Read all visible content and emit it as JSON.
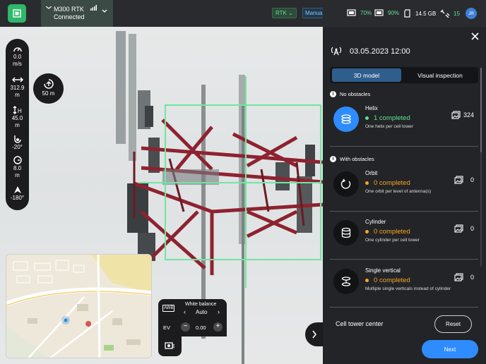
{
  "top_bar": {
    "drone_name": "M300 RTK",
    "drone_status": "Connected",
    "rtk_label": "RTK",
    "flight_mode": "Manual flight",
    "battery_1": "70%",
    "battery_2": "90%",
    "storage": "14.5 GB",
    "satellites": "15",
    "user_initials": "JR",
    "accent": "#2fb86a"
  },
  "telemetry": {
    "speed_value": "0.0",
    "speed_unit": "m/s",
    "distance_value": "312.9",
    "distance_unit": "m",
    "height_value": "45.0",
    "height_unit": "m",
    "gimbal_pitch": "-20°",
    "altitude_value": "8.0",
    "altitude_unit": "m",
    "heading": "-180°",
    "rth_value": "50 m"
  },
  "camera_settings": {
    "white_balance_label": "White balance",
    "white_balance_value": "Auto",
    "awb_badge": "AWB",
    "ev_label": "EV",
    "ev_value": "0.00"
  },
  "panel": {
    "datetime": "03.05.2023 12:00",
    "tabs": [
      {
        "label": "3D model",
        "active": true
      },
      {
        "label": "Visual inspection",
        "active": false
      }
    ],
    "section_no_obstacles": "No obstacles",
    "section_with_obstacles": "With obstacles",
    "missions": [
      {
        "title": "Helix",
        "status": "1 completed",
        "description": "One helix per cell tower",
        "count": "324",
        "status_color": "#5ee092"
      },
      {
        "title": "Orbit",
        "status": "0 completed",
        "description": "One orbit per level of antenna(s)",
        "count": "0",
        "status_color": "#f5a623"
      },
      {
        "title": "Cylinder",
        "status": "0 completed",
        "description": "One cylinder per cell tower",
        "count": "0",
        "status_color": "#f5a623"
      },
      {
        "title": "Single vertical",
        "status": "0 completed",
        "description": "Multiple single verticals instead of cylinder",
        "count": "0",
        "status_color": "#f5a623"
      }
    ],
    "footer_label": "Cell tower center",
    "reset_label": "Reset",
    "next_label": "Next"
  },
  "icons": [
    "home-icon",
    "drone-icon",
    "signal-icon",
    "chevron-down-icon",
    "battery-icon",
    "sd-card-icon",
    "satellite-icon",
    "close-icon",
    "antenna-icon",
    "info-icon",
    "image-icon",
    "helix-icon",
    "orbit-icon",
    "cylinder-icon",
    "vertical-icon",
    "chevron-right-icon"
  ]
}
